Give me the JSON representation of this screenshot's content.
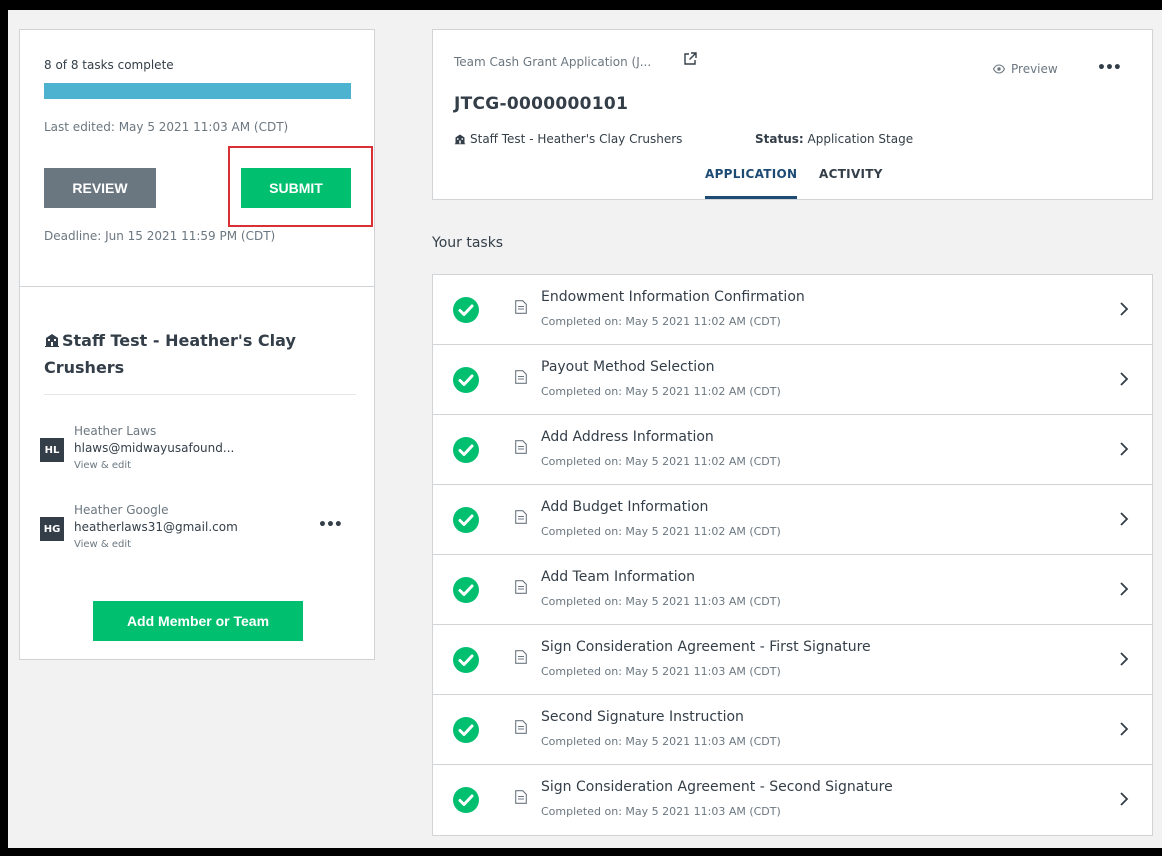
{
  "sidebar": {
    "tasks_complete": "8 of 8 tasks complete",
    "progress_fraction": 1.0,
    "progress_color": "#4cb2d0",
    "last_edited": "Last edited: May 5 2021 11:03 AM (CDT)",
    "review_label": "REVIEW",
    "submit_label": "SUBMIT",
    "deadline": "Deadline: Jun 15 2021 11:59 PM (CDT)",
    "team_name": "Staff Test - Heather's Clay Crushers",
    "members": [
      {
        "initials": "HL",
        "name": "Heather Laws",
        "email": "hlaws@midwayusafound...",
        "edit": "View & edit"
      },
      {
        "initials": "HG",
        "name": "Heather Google",
        "email": "heatherlaws31@gmail.com",
        "edit": "View & edit"
      }
    ],
    "more_label": "•••",
    "add_label": "Add Member or Team"
  },
  "header": {
    "app_title": "Team Cash Grant Application (J...",
    "preview_label": "Preview",
    "more_label": "•••",
    "app_id": "JTCG-0000000101",
    "org": "Staff Test - Heather's Clay Crushers",
    "status_label": "Status:",
    "status_value": "Application Stage",
    "tabs": [
      {
        "label": "APPLICATION",
        "active": true
      },
      {
        "label": "ACTIVITY",
        "active": false
      }
    ]
  },
  "tasks": {
    "heading": "Your tasks",
    "items": [
      {
        "title": "Endowment Information Confirmation",
        "completed": "Completed on: May 5 2021 11:02 AM (CDT)"
      },
      {
        "title": "Payout Method Selection",
        "completed": "Completed on: May 5 2021 11:02 AM (CDT)"
      },
      {
        "title": "Add Address Information",
        "completed": "Completed on: May 5 2021 11:02 AM (CDT)"
      },
      {
        "title": "Add Budget Information",
        "completed": "Completed on: May 5 2021 11:02 AM (CDT)"
      },
      {
        "title": "Add Team Information",
        "completed": "Completed on: May 5 2021 11:03 AM (CDT)"
      },
      {
        "title": "Sign Consideration Agreement - First Signature",
        "completed": "Completed on: May 5 2021 11:03 AM (CDT)"
      },
      {
        "title": "Second Signature Instruction",
        "completed": "Completed on: May 5 2021 11:03 AM (CDT)"
      },
      {
        "title": "Sign Consideration Agreement - Second Signature",
        "completed": "Completed on: May 5 2021 11:03 AM (CDT)"
      }
    ]
  },
  "colors": {
    "primary_green": "#00bf6f",
    "review_gray": "#6b7780",
    "highlight_red": "#d93035",
    "tab_active": "#1e4b73"
  }
}
